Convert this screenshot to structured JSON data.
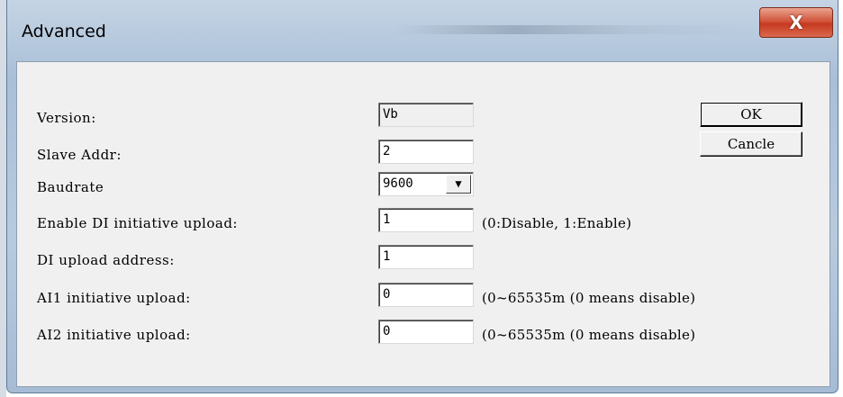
{
  "window": {
    "title": "Advanced",
    "close_glyph": "X"
  },
  "form": {
    "version": {
      "label": "Version:",
      "value": "Vb"
    },
    "slave_addr": {
      "label": "Slave Addr:",
      "value": "2"
    },
    "baudrate": {
      "label": "Baudrate",
      "value": "9600",
      "arrow": "▼"
    },
    "enable_di": {
      "label": "Enable DI initiative upload:",
      "value": "1",
      "hint": "(0:Disable, 1:Enable)"
    },
    "di_address": {
      "label": "DI upload address:",
      "value": "1"
    },
    "ai1": {
      "label": "AI1 initiative upload:",
      "value": "0",
      "hint": "(0~65535m (0 means disable)"
    },
    "ai2": {
      "label": "AI2 initiative upload:",
      "value": "0",
      "hint": "(0~65535m (0 means disable)"
    }
  },
  "buttons": {
    "ok": "OK",
    "cancel": "Cancle"
  },
  "icons": {
    "close": "close-icon",
    "dropdown": "chevron-down-icon"
  }
}
